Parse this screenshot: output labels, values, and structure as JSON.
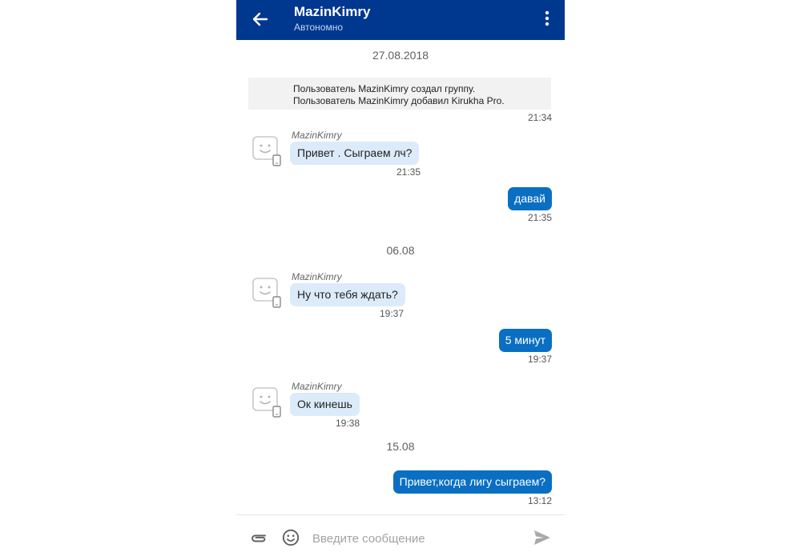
{
  "colors": {
    "header": "#00378f",
    "incoming_bubble": "#dcebfa",
    "outgoing_bubble": "#0a6fc2",
    "system_box": "#f2f2f2"
  },
  "header": {
    "back_icon": "arrow-left-icon",
    "title": "MazinKimry",
    "subtitle": "Автономно",
    "menu_icon": "more-vertical-icon"
  },
  "messages": {
    "date1": "27.08.2018",
    "system": {
      "line1": "Пользователь MazinKimry создал группу.",
      "line2": "Пользователь MazinKimry добавил Kirukha Pro.",
      "time": "21:34"
    },
    "m1": {
      "sender": "MazinKimry",
      "text": "Привет . Сыграем лч?",
      "time": "21:35"
    },
    "m2": {
      "text": "давай",
      "time": "21:35"
    },
    "date2": "06.08",
    "m3": {
      "sender": "MazinKimry",
      "text": "Ну что тебя ждать?",
      "time": "19:37"
    },
    "m4": {
      "text": "5 минут",
      "time": "19:37"
    },
    "m5": {
      "sender": "MazinKimry",
      "text": "Ок кинешь",
      "time": "19:38"
    },
    "date3": "15.08",
    "m6": {
      "text": "Привет,когда лигу сыграем?",
      "time": "13:12"
    }
  },
  "composer": {
    "attach_icon": "paperclip-icon",
    "emoji_icon": "smiley-icon",
    "placeholder": "Введите сообщение",
    "send_icon": "send-icon"
  }
}
